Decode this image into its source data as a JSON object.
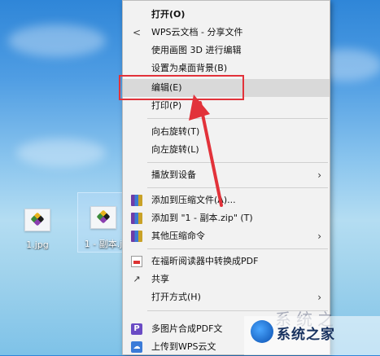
{
  "desktop": {
    "files": [
      {
        "name": "1.jpg"
      },
      {
        "name": "1 - 副本.j"
      }
    ]
  },
  "context_menu": {
    "items": [
      {
        "label": "打开(O)",
        "bold": true,
        "icon": ""
      },
      {
        "label": "WPS云文档 - 分享文件",
        "icon": "share-icon"
      },
      {
        "label": "使用画图 3D 进行编辑",
        "icon": ""
      },
      {
        "label": "设置为桌面背景(B)",
        "icon": ""
      },
      {
        "label": "编辑(E)",
        "icon": "",
        "highlighted": true
      },
      {
        "label": "打印(P)",
        "icon": ""
      },
      {
        "label": "向右旋转(T)",
        "icon": ""
      },
      {
        "label": "向左旋转(L)",
        "icon": ""
      },
      {
        "label": "播放到设备",
        "icon": "",
        "submenu": true
      },
      {
        "label": "添加到压缩文件(A)...",
        "icon": "archive-icon"
      },
      {
        "label": "添加到 \"1 - 副本.zip\" (T)",
        "icon": "archive-icon"
      },
      {
        "label": "其他压缩命令",
        "icon": "archive-icon",
        "submenu": true
      },
      {
        "label": "在福昕阅读器中转换成PDF",
        "icon": "pdf-doc-icon"
      },
      {
        "label": "共享",
        "icon": "share-icon"
      },
      {
        "label": "打开方式(H)",
        "icon": "",
        "submenu": true
      },
      {
        "label": "多图片合成PDF文",
        "icon": "pdf-merge-icon"
      },
      {
        "label": "上传到WPS云文",
        "icon": "cloud-upload-icon"
      }
    ],
    "submenu_arrow": "›"
  },
  "annotation": {
    "color": "#e2323a"
  },
  "watermark": {
    "text": "系统之家"
  }
}
